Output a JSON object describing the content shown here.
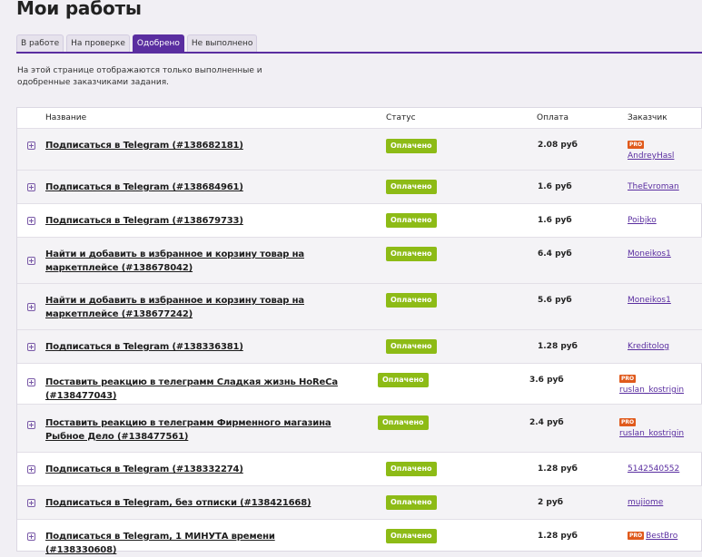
{
  "page": {
    "title": "Мои работы"
  },
  "tabs": [
    {
      "label": "В работе",
      "active": false
    },
    {
      "label": "На проверке",
      "active": false
    },
    {
      "label": "Одобрено",
      "active": true
    },
    {
      "label": "Не выполнено",
      "active": false
    }
  ],
  "description": "На этой странице отображаются только выполненные и одобренные заказчиками задания.",
  "table": {
    "headers": {
      "name": "Название",
      "status": "Статус",
      "payment": "Оплата",
      "customer": "Заказчик"
    },
    "rows": [
      {
        "title": "Подписаться в Telegram (#138682181)",
        "status": "Оплачено",
        "payment": "2.08 руб",
        "customer": "AndreyHasl",
        "pro": "PRO"
      },
      {
        "title": "Подписаться в Telegram (#138684961)",
        "status": "Оплачено",
        "payment": "1.6 руб",
        "customer": "TheEvroman"
      },
      {
        "title": "Подписаться в Telegram (#138679733)",
        "status": "Оплачено",
        "payment": "1.6 руб",
        "customer": "Poibjko"
      },
      {
        "title": "Найти и добавить в избранное и корзину товар на маркетплейсе (#138678042)",
        "status": "Оплачено",
        "payment": "6.4 руб",
        "customer": "Moneikos1"
      },
      {
        "title": "Найти и добавить в избранное и корзину товар на маркетплейсе (#138677242)",
        "status": "Оплачено",
        "payment": "5.6 руб",
        "customer": "Moneikos1"
      },
      {
        "title": "Подписаться в Telegram (#138336381)",
        "status": "Оплачено",
        "payment": "1.28 руб",
        "customer": "Kreditolog"
      },
      {
        "title": "Поставить реакцию в телеграмм Сладкая жизнь HoReCa (#138477043)",
        "status": "Оплачено",
        "payment": "3.6 руб",
        "customer": "ruslan_kostrigin",
        "pro": "PRO"
      },
      {
        "title": "Поставить реакцию в телеграмм Фирменного магазина Рыбное Дело (#138477561)",
        "status": "Оплачено",
        "payment": "2.4 руб",
        "customer": "ruslan_kostrigin",
        "pro": "PRO"
      },
      {
        "title": "Подписаться в Telegram (#138332274)",
        "status": "Оплачено",
        "payment": "1.28 руб",
        "customer": "5142540552"
      },
      {
        "title": "Подписаться в Telegram, без отписки (#138421668)",
        "status": "Оплачено",
        "payment": "2 руб",
        "customer": "mujiome"
      },
      {
        "title": "Подписаться в Telegram, 1 МИНУТА времени (#138330608)",
        "status": "Оплачено",
        "payment": "1.28 руб",
        "customer": "BestBro",
        "pro": "PRO"
      }
    ]
  }
}
